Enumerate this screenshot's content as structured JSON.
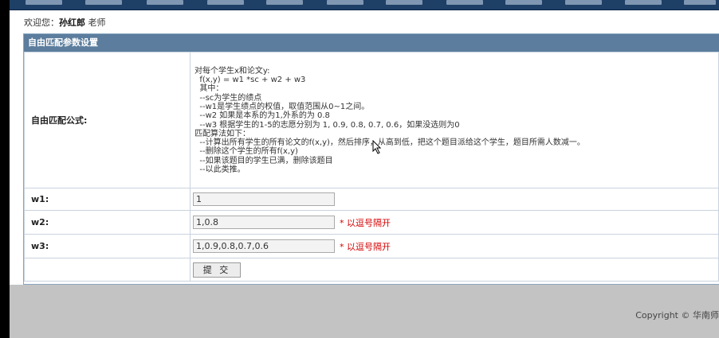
{
  "welcome": {
    "prefix": "欢迎您：",
    "user_name": "孙红郎",
    "role": "老师"
  },
  "panel": {
    "title": "自由匹配参数设置"
  },
  "formula": {
    "label": "自由匹配公式:",
    "lines": [
      "对每个学生x和论文y:",
      "  f(x,y) = w1 *sc + w2 + w3",
      "  其中：",
      "  --sc为学生的绩点",
      "  --w1是学生绩点的权值，取值范围从0~1之间。",
      "  --w2 如果是本系的为1,外系的为 0.8",
      "  --w3 根据学生的1-5的志愿分别为 1, 0.9, 0.8, 0.7, 0.6，如果没选则为0",
      "匹配算法如下：",
      "  --计算出所有学生的所有论文的f(x,y)，然后排序，从高到低，把这个题目派给这个学生，题目所需人数减一。",
      "  --删除这个学生的所有f(x,y)",
      "  --如果该题目的学生已满，删除该题目",
      "  --以此类推。"
    ]
  },
  "fields": {
    "w1": {
      "label": "w1:",
      "value": "1",
      "hint": ""
    },
    "w2": {
      "label": "w2:",
      "value": "1,0.8",
      "hint": "* 以逗号隔开"
    },
    "w3": {
      "label": "w3:",
      "value": "1,0.9,0.8,0.7,0.6",
      "hint": "* 以逗号隔开"
    }
  },
  "submit": {
    "label": "提 交"
  },
  "footer": {
    "copyright": "Copyright © 华南师"
  }
}
